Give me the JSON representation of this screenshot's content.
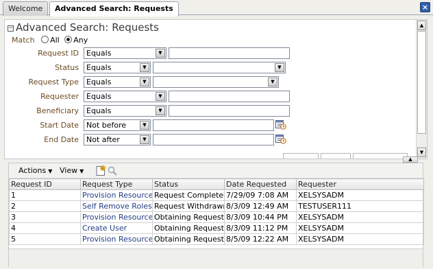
{
  "tabs": [
    {
      "label": "Welcome",
      "active": false
    },
    {
      "label": "Advanced Search: Requests",
      "active": true
    }
  ],
  "close_label": "×",
  "search": {
    "title": "Advanced Search: Requests",
    "collapse_glyph": "−",
    "match": {
      "label": "Match",
      "options": [
        "All",
        "Any"
      ],
      "selected": "Any"
    },
    "fields": [
      {
        "label": "Request ID",
        "operator": "Equals",
        "value": "",
        "value_type": "text"
      },
      {
        "label": "Status",
        "operator": "Equals",
        "value": "",
        "value_type": "select"
      },
      {
        "label": "Request Type",
        "operator": "Equals",
        "value": "",
        "value_type": "select"
      },
      {
        "label": "Requester",
        "operator": "Equals",
        "value": "",
        "value_type": "text"
      },
      {
        "label": "Beneficiary",
        "operator": "Equals",
        "value": "",
        "value_type": "text"
      },
      {
        "label": "Start Date",
        "operator": "Not before",
        "value": "",
        "value_type": "date"
      },
      {
        "label": "End Date",
        "operator": "Not after",
        "value": "",
        "value_type": "date"
      }
    ]
  },
  "results": {
    "toolbar": {
      "actions_label": "Actions",
      "view_label": "View"
    },
    "columns": [
      "Request ID",
      "Request Type",
      "Status",
      "Date Requested",
      "Requester"
    ],
    "rows": [
      [
        "1",
        "Provision Resource",
        "Request Completed",
        "7/29/09 7:08 AM",
        "XELSYSADM"
      ],
      [
        "2",
        "Self Remove Roles",
        "Request Withdrawn",
        "8/3/09 12:49 AM",
        "TESTUSER111"
      ],
      [
        "3",
        "Provision Resource",
        "Obtaining Request Ap",
        "8/3/09 10:44 PM",
        "XELSYSADM"
      ],
      [
        "4",
        "Create User",
        "Obtaining Request Ap",
        "8/3/09 11:12 PM",
        "XELSYSADM"
      ],
      [
        "5",
        "Provision Resource",
        "Obtaining Request Ap",
        "8/5/09 12:22 AM",
        "XELSYSADM"
      ]
    ]
  },
  "colors": {
    "label_brown": "#6b4a1f",
    "link_blue": "#233e85",
    "close_blue": "#3160a8"
  }
}
